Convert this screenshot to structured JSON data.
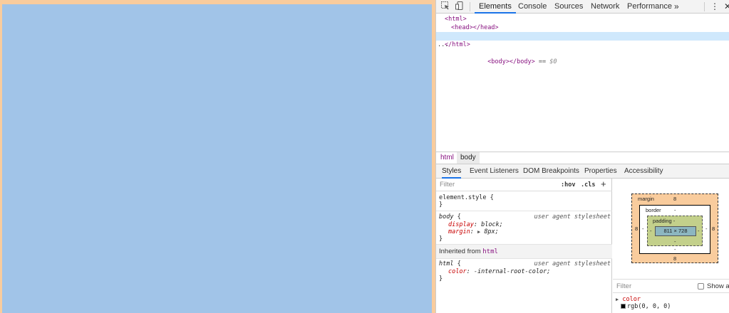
{
  "toolbar": {
    "inspect_icon": "inspect-icon",
    "device_icon": "device-toggle-icon",
    "tabs": [
      "Elements",
      "Console",
      "Sources",
      "Network",
      "Performance"
    ],
    "overflow": "»",
    "menu": "⋮",
    "close": "✕"
  },
  "dom": {
    "line1": "<html>",
    "line2_open": "<head>",
    "line2_close": "</head>",
    "line3_open": "<body>",
    "line3_close": "</body>",
    "line3_eq": " == ",
    "line3_ref": "$0",
    "line3_dots": "...",
    "line4": "</html>"
  },
  "breadcrumb": [
    "html",
    "body"
  ],
  "subtabs": [
    "Styles",
    "Event Listeners",
    "DOM Breakpoints",
    "Properties",
    "Accessibility"
  ],
  "styles": {
    "filter_placeholder": "Filter",
    "hov": ":hov",
    "cls": ".cls",
    "plus": "+",
    "element_style": "element.style {",
    "close_brace": "}",
    "body_selector": "body",
    "open_brace": " {",
    "ua_source": "user agent stylesheet",
    "display_prop": "display",
    "display_val": "block;",
    "margin_prop": "margin",
    "margin_val": "8px;",
    "inherited_label": "Inherited from ",
    "inherited_tag": "html",
    "html_selector": "html",
    "color_prop": "color",
    "color_val": "-internal-root-color;"
  },
  "boxmodel": {
    "margin_label": "margin",
    "margin_top": "8",
    "margin_bottom": "8",
    "margin_left": "8",
    "margin_right": "8",
    "border_label": "border",
    "border_val": "-",
    "border_bottom": "-",
    "border_left": "-",
    "border_right": "-",
    "padding_label": "padding -",
    "padding_bottom": "-",
    "padding_left": "-",
    "padding_right": "-",
    "content": "811 × 728",
    "filter_placeholder": "Filter",
    "show_all": "Show all",
    "computed_prop": "color",
    "computed_val": "rgb(0, 0, 0)"
  },
  "colors": {
    "margin": "#f9cc9d",
    "content_highlight": "#a1c4e8",
    "padding": "#c3d08b",
    "content_box": "#8cb6c0",
    "accent": "#1a73e8"
  }
}
